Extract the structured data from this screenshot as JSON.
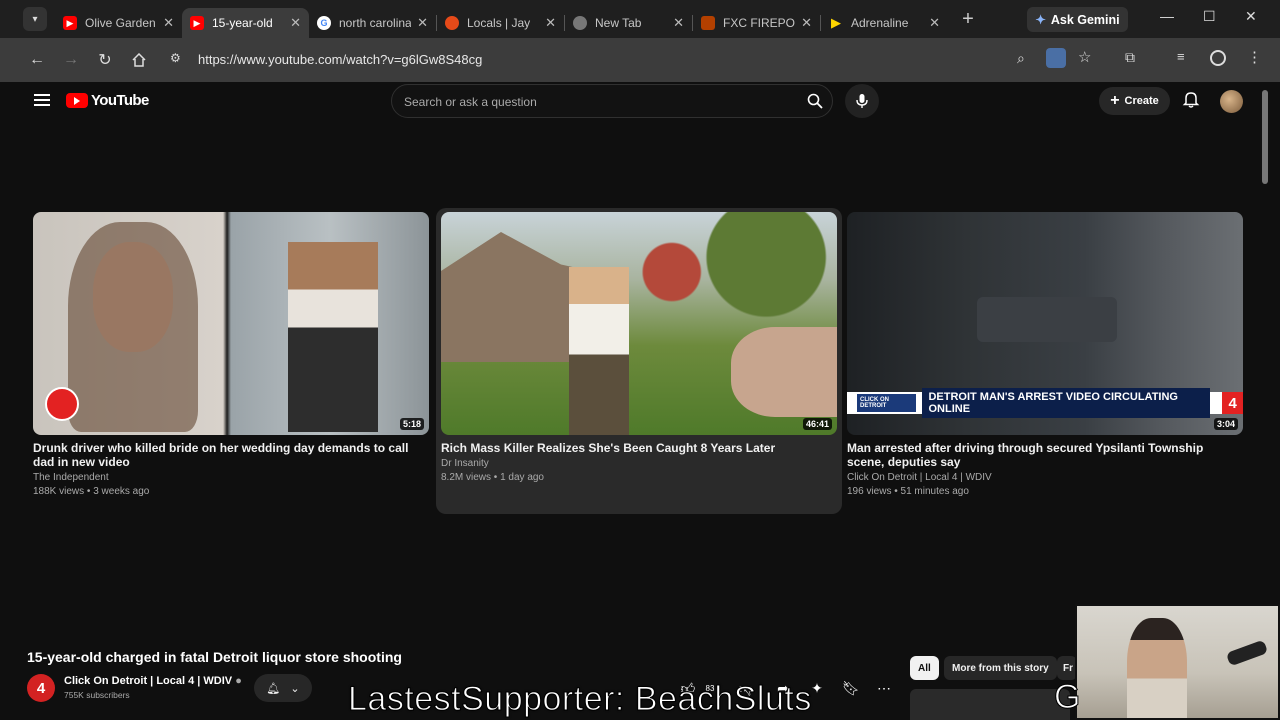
{
  "browser": {
    "tabs": [
      {
        "title": "Olive Garden",
        "favicon": "youtube-icon",
        "color": "#ff0000",
        "active": false
      },
      {
        "title": "15-year-old",
        "favicon": "youtube-icon",
        "color": "#ff0000",
        "active": true
      },
      {
        "title": "north carolina",
        "favicon": "google-icon",
        "color": "#4285f4",
        "active": false
      },
      {
        "title": "Locals | Jay",
        "favicon": "locals-icon",
        "color": "#e64a19",
        "active": false
      },
      {
        "title": "New Tab",
        "favicon": "chrome-icon",
        "color": "#888888",
        "active": false
      },
      {
        "title": "FXC FIREPO",
        "favicon": "fxc-icon",
        "color": "#b34000",
        "active": false
      },
      {
        "title": "Adrenaline",
        "favicon": "play-icon",
        "color": "#ffd600",
        "active": false
      }
    ],
    "ask_gemini": "Ask Gemini",
    "url": "https://www.youtube.com/watch?v=g6lGw8S48cg"
  },
  "youtube": {
    "brand": "YouTube",
    "search_placeholder": "Search or ask a question",
    "create_label": "Create",
    "related": [
      {
        "title_line1": "Drunk driver who killed bride on her wedding day demands to call dad in new",
        "title_line2": "video",
        "channel": "The Independent",
        "meta": "188K views • 3 weeks ago",
        "duration": "5:18"
      },
      {
        "title_line1": "Rich Mass Killer Realizes She's Been Caught 8 Years Later",
        "title_line2": "",
        "channel": "Dr Insanity",
        "meta": "8.2M views • 1 day ago",
        "duration": "46:41"
      },
      {
        "title_line1": "Man arrested after driving through secured Ypsilanti Township scene,",
        "title_line2": "deputies say",
        "channel": "Click On Detroit | Local 4 | WDIV",
        "meta": "196 views • 51 minutes ago",
        "duration": "3:04",
        "banner": "DETROIT MAN'S ARREST VIDEO CIRCULATING ONLINE",
        "banner_brand": "CLICK ON DETROIT"
      }
    ],
    "video": {
      "title": "15-year-old charged in fatal Detroit liquor store shooting",
      "channel": "Click On Detroit | Local 4 | WDIV",
      "channel_logo": "4",
      "subscribers": "755K subscribers",
      "likes": "83"
    },
    "chips": [
      "All",
      "More from this story",
      "Fr"
    ]
  },
  "stream_overlay": "LastestSupporter: BeachSluts",
  "stream_overlay_right": "G"
}
